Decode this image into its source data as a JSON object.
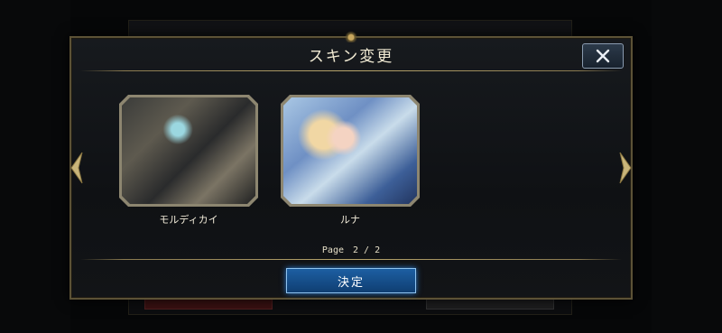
{
  "dialog": {
    "title": "スキン変更",
    "page_indicator": "Page　2 / 2",
    "confirm_label": "決定"
  },
  "skins": [
    {
      "name": "モルディカイ"
    },
    {
      "name": "ルナ"
    }
  ],
  "background": {
    "title_text": "ルナ"
  },
  "colors": {
    "border_gold": "#5c5236",
    "confirm_blue": "#1d5fa2",
    "close_blue": "#2c3a4a"
  },
  "icons": {
    "close": "close-icon",
    "prev": "arrow-left-icon",
    "next": "arrow-right-icon"
  }
}
